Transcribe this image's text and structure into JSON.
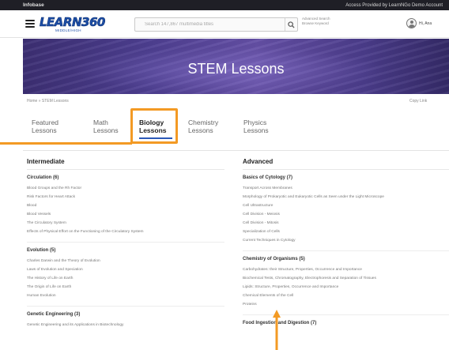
{
  "topbar": {
    "brand": "Infobase",
    "access": "Access Provided by LearnNGo Demo Account"
  },
  "header": {
    "logo_main": "LEARN360",
    "logo_sub": "MIDDLE/HIGH",
    "search_placeholder": "Search 147,867 multimedia titles",
    "advanced_search": "Advanced Search",
    "browse_keyword": "Browse Keyword",
    "user_label": "Hi, Ana"
  },
  "banner": {
    "title": "STEM Lessons"
  },
  "breadcrumb": {
    "text": "Home » STEM Lessons",
    "copy_link": "Copy Link"
  },
  "tabs": [
    {
      "line1": "Featured",
      "line2": "Lessons"
    },
    {
      "line1": "Math",
      "line2": "Lessons"
    },
    {
      "line1": "Biology",
      "line2": "Lessons"
    },
    {
      "line1": "Chemistry",
      "line2": "Lessons"
    },
    {
      "line1": "Physics",
      "line2": "Lessons"
    }
  ],
  "left": {
    "heading": "Intermediate",
    "topics": [
      {
        "title": "Circulation (6)",
        "lessons": [
          "Blood Groups and the Rh Factor",
          "Risk Factors for Heart Attack",
          "Blood",
          "Blood Vessels",
          "The Circulatory System",
          "Effects of Physical Effort on the Functioning of the Circulatory System"
        ]
      },
      {
        "title": "Evolution (5)",
        "lessons": [
          "Charles Darwin and the Theory of Evolution",
          "Laws of Evolution and Speciation",
          "The History of Life on Earth",
          "The Origin of Life on Earth",
          "Human Evolution"
        ]
      },
      {
        "title": "Genetic Engineering (3)",
        "lessons": [
          "Genetic Engineering and its Applications in Biotechnology"
        ]
      }
    ]
  },
  "right": {
    "heading": "Advanced",
    "topics": [
      {
        "title": "Basics of Cytology (7)",
        "lessons": [
          "Transport Across Membranes",
          "Morphology of Prokaryotic and Eukaryotic Cells as Seen under the Light Microscope",
          "Cell Ultrastructure",
          "Cell Division - Meiosis",
          "Cell Division - Mitosis",
          "Specialization of Cells",
          "Current Techniques in Cytology"
        ]
      },
      {
        "title": "Chemistry of Organisms (5)",
        "lessons": [
          "Carbohydrates: their Structure, Properties, Occurrence and Importance",
          "Biochemical Tests, Chromatography, Electrophoresis and Separation of Tissues",
          "Lipids: Structure, Properties, Occurrence and Importance",
          "Chemical Elements of the Cell",
          "Proteins"
        ]
      },
      {
        "title": "Food Ingestion and Digestion (7)",
        "lessons": []
      }
    ]
  },
  "colors": {
    "accent": "#2b58b8",
    "highlight": "#f39a24",
    "banner": "#4e3f92"
  }
}
